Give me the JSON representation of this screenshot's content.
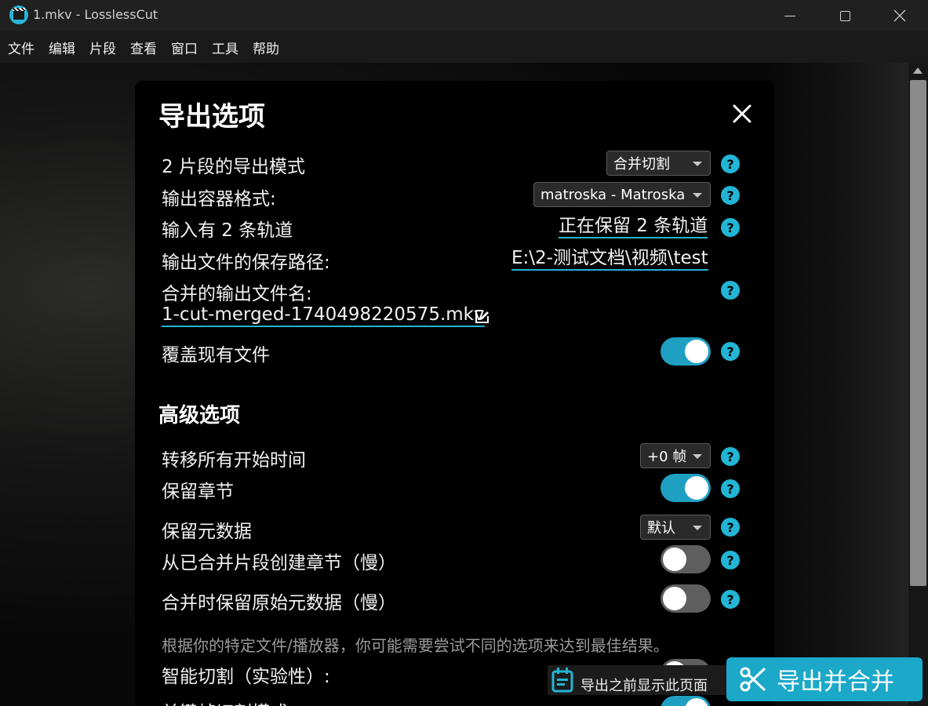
{
  "window": {
    "title": "1.mkv - LosslessCut"
  },
  "menu": [
    "文件",
    "编辑",
    "片段",
    "查看",
    "窗口",
    "工具",
    "帮助"
  ],
  "dialog": {
    "title": "导出选项",
    "rows": {
      "export_mode_label": "2 片段的导出模式",
      "export_mode_value": "合并切割",
      "container_label": "输出容器格式:",
      "container_value": "matroska - Matroska",
      "tracks_label": "输入有 2 条轨道",
      "tracks_value": "正在保留 2 条轨道",
      "save_path_label": "输出文件的保存路径:",
      "save_path_value": "E:\\2-测试文档\\视频\\test",
      "merged_name_label": "合并的输出文件名:",
      "merged_name_value": "1-cut-merged-1740498220575.mkv",
      "overwrite_label": "覆盖现有文件"
    },
    "advanced": {
      "title": "高级选项",
      "shift_start_label": "转移所有开始时间",
      "shift_start_value": "+0 帧",
      "keep_chapters_label": "保留章节",
      "keep_metadata_label": "保留元数据",
      "keep_metadata_value": "默认",
      "create_chapters_label": "从已合并片段创建章节（慢）",
      "preserve_meta_merge_label": "合并时保留原始元数据（慢）",
      "note": "根据你的特定文件/播放器，你可能需要尝试不同的选项来达到最佳结果。",
      "smart_cut_label": "智能切割（实验性）:",
      "keyframe_cut_label": "关键帧切割模式"
    },
    "toggles": {
      "overwrite": true,
      "keep_chapters": true,
      "create_chapters": false,
      "preserve_meta_merge": false
    },
    "help_glyph": "?"
  },
  "footer": {
    "show_page_label": "导出之前显示此页面",
    "export_button_label": "导出并合并"
  },
  "colors": {
    "accent": "#22b5d5",
    "toggle_on": "#1f9fc1",
    "export_button": "#1ba8c9"
  }
}
